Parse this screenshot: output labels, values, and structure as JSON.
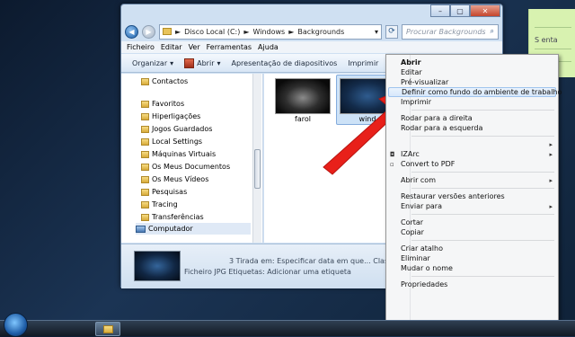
{
  "sticky_note": {
    "text": "S enta"
  },
  "window": {
    "controls": {
      "minimize": "–",
      "maximize": "▢",
      "close": "✕"
    },
    "address": {
      "parts": [
        "Disco Local (C:)",
        "Windows",
        "Backgrounds"
      ],
      "separator": "►"
    },
    "search_placeholder": "Procurar Backgrounds",
    "menu": [
      "Ficheiro",
      "Editar",
      "Ver",
      "Ferramentas",
      "Ajuda"
    ],
    "toolbar": {
      "organize": "Organizar",
      "open": "Abrir",
      "slideshow": "Apresentação de diapositivos",
      "print": "Imprimir"
    },
    "nav_items": [
      {
        "label": "Contactos",
        "kind": "folder"
      },
      {
        "label": "Favoritos",
        "kind": "folder"
      },
      {
        "label": "Hiperligações",
        "kind": "folder"
      },
      {
        "label": "Jogos Guardados",
        "kind": "folder"
      },
      {
        "label": "Local Settings",
        "kind": "folder"
      },
      {
        "label": "Máquinas Virtuais",
        "kind": "folder"
      },
      {
        "label": "Os Meus Documentos",
        "kind": "folder"
      },
      {
        "label": "Os Meus Vídeos",
        "kind": "folder"
      },
      {
        "label": "Pesquisas",
        "kind": "folder"
      },
      {
        "label": "Tracing",
        "kind": "folder"
      },
      {
        "label": "Transferências",
        "kind": "folder"
      },
      {
        "label": "Computador",
        "kind": "computer"
      }
    ],
    "files": [
      {
        "name": "farol"
      },
      {
        "name": "wind"
      }
    ],
    "details": {
      "line1": "3   Tirada em: Especificar data em que...  Classificação",
      "line2": "Ficheiro JPG   Etiquetas: Adicionar uma etiqueta"
    }
  },
  "context_menu": [
    {
      "label": "Abrir",
      "bold": true
    },
    {
      "label": "Editar"
    },
    {
      "label": "Pré-visualizar"
    },
    {
      "label": "Definir como fundo do ambiente de trabalho",
      "highlighted": true
    },
    {
      "label": "Imprimir"
    },
    {
      "sep": true
    },
    {
      "label": "Rodar para a direita"
    },
    {
      "label": "Rodar para a esquerda"
    },
    {
      "sep": true
    },
    {
      "label": "",
      "submenu": true
    },
    {
      "label": "IZArc",
      "submenu": true,
      "icon": "izarc-icon"
    },
    {
      "label": "Convert to PDF",
      "icon": "pdf-icon"
    },
    {
      "sep": true
    },
    {
      "label": "Abrir com",
      "submenu": true
    },
    {
      "sep": true
    },
    {
      "label": "Restaurar versões anteriores"
    },
    {
      "label": "Enviar para",
      "submenu": true
    },
    {
      "sep": true
    },
    {
      "label": "Cortar"
    },
    {
      "label": "Copiar"
    },
    {
      "sep": true
    },
    {
      "label": "Criar atalho"
    },
    {
      "label": "Eliminar"
    },
    {
      "label": "Mudar o nome"
    },
    {
      "sep": true
    },
    {
      "label": "Propriedades"
    }
  ],
  "colors": {
    "highlight": "#d6e7fb",
    "arrow": "#e8201a"
  }
}
